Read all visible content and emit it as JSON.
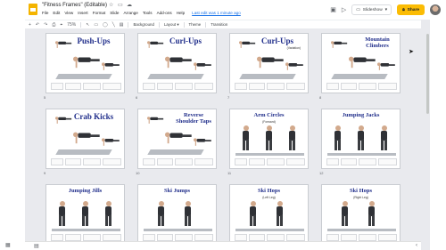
{
  "app": {
    "doc_title": "\"Fitness Frames\" (Editable)",
    "last_edit": "Last edit was 1 minute ago",
    "menu": [
      "File",
      "Edit",
      "View",
      "Insert",
      "Format",
      "Slide",
      "Arrange",
      "Tools",
      "Add-ons",
      "Help"
    ],
    "slideshow_label": "Slideshow",
    "share_label": "Share",
    "brand_color": "#f4b400",
    "share_color": "#fbbc04",
    "title_color": "#1f2d8a"
  },
  "toolbar": {
    "items": [
      "+",
      "↶",
      "↷",
      "⎙",
      "⌖",
      "75%",
      "↖",
      "▭",
      "◯",
      "╲",
      "▤",
      "Background",
      "Layout ▾",
      "Theme",
      "Transition"
    ]
  },
  "slides": [
    {
      "num": "5",
      "title": "Push-Ups",
      "pose": "floor"
    },
    {
      "num": "6",
      "title": "Curl-Ups",
      "pose": "floor"
    },
    {
      "num": "7",
      "title": "Curl-Ups",
      "subtitle": "(Variation)",
      "pose": "floor"
    },
    {
      "num": "8",
      "title": "Mountain Climbers",
      "pose": "floor"
    },
    {
      "num": "9",
      "title": "Crab Kicks",
      "pose": "floor"
    },
    {
      "num": "10",
      "title": "Reverse Shoulder Taps",
      "pose": "floor"
    },
    {
      "num": "11",
      "title": "Arm Circles",
      "subtitle": "(Forward)",
      "pose": "stand"
    },
    {
      "num": "12",
      "title": "Jumping Jacks",
      "pose": "stand"
    },
    {
      "num": "13",
      "title": "Jumping Jills",
      "pose": "stand"
    },
    {
      "num": "14",
      "title": "Ski Jumps",
      "pose": "stand"
    },
    {
      "num": "15",
      "title": "Ski Hops",
      "subtitle": "(Left Leg)",
      "pose": "stand"
    },
    {
      "num": "16",
      "title": "Ski Hops",
      "subtitle": "(Right Leg)",
      "pose": "stand"
    }
  ],
  "icons": {
    "star": "star-icon",
    "drive": "folder-icon",
    "cloud": "cloud-icon",
    "comment": "comment-icon",
    "present": "present-icon",
    "lock": "lock-icon",
    "grid": "grid-view-icon",
    "filmstrip": "filmstrip-view-icon",
    "collapse": "chevron-up-icon"
  }
}
